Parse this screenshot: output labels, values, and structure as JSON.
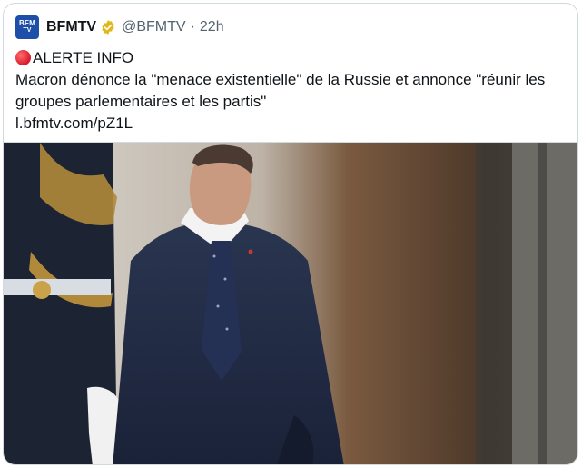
{
  "tweet": {
    "author_name": "BFMTV",
    "avatar_text_line1": "BFM",
    "avatar_text_line2": "TV",
    "handle": "@BFMTV",
    "separator": "·",
    "time": "22h",
    "alert_label": "ALERTE INFO",
    "body_line1": "Macron dénonce la \"menace existentielle\" de la Russie et annonce \"réunir les",
    "body_line2": "groupes parlementaires et les partis\"",
    "link": "l.bfmtv.com/pZ1L"
  },
  "colors": {
    "avatar_bg": "#1d4fa8",
    "verified_badge": "#e2b719",
    "alert_circle": "#d7192b",
    "secondary_text": "#536471"
  },
  "icons": {
    "verified": "gold-verified-badge-icon",
    "alert": "red-circle-emoji-icon"
  }
}
